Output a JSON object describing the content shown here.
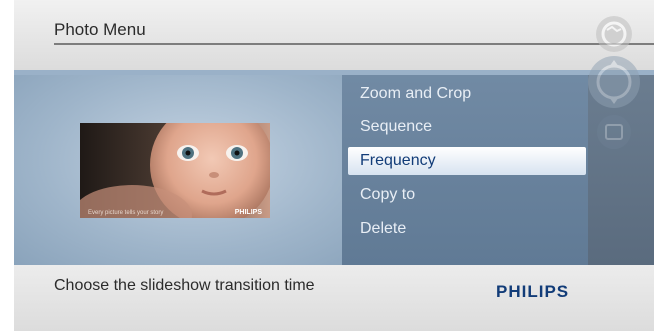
{
  "header": {
    "title": "Photo Menu"
  },
  "preview": {
    "caption": "Every picture tells your story",
    "brand": "PHILIPS"
  },
  "menu": {
    "items": [
      {
        "label": "Zoom and Crop",
        "selected": false
      },
      {
        "label": "Sequence",
        "selected": false
      },
      {
        "label": "Frequency",
        "selected": true
      },
      {
        "label": "Copy to",
        "selected": false
      },
      {
        "label": "Delete",
        "selected": false
      }
    ]
  },
  "footer": {
    "hint": "Choose the slideshow transition time",
    "logo": "PHILIPS"
  },
  "controls": [
    "globe-icon",
    "navigation-dial-icon",
    "back-icon"
  ],
  "colors": {
    "accent": "#123c78",
    "menu_bg": "#6a839e",
    "highlight": "#ffffff"
  }
}
